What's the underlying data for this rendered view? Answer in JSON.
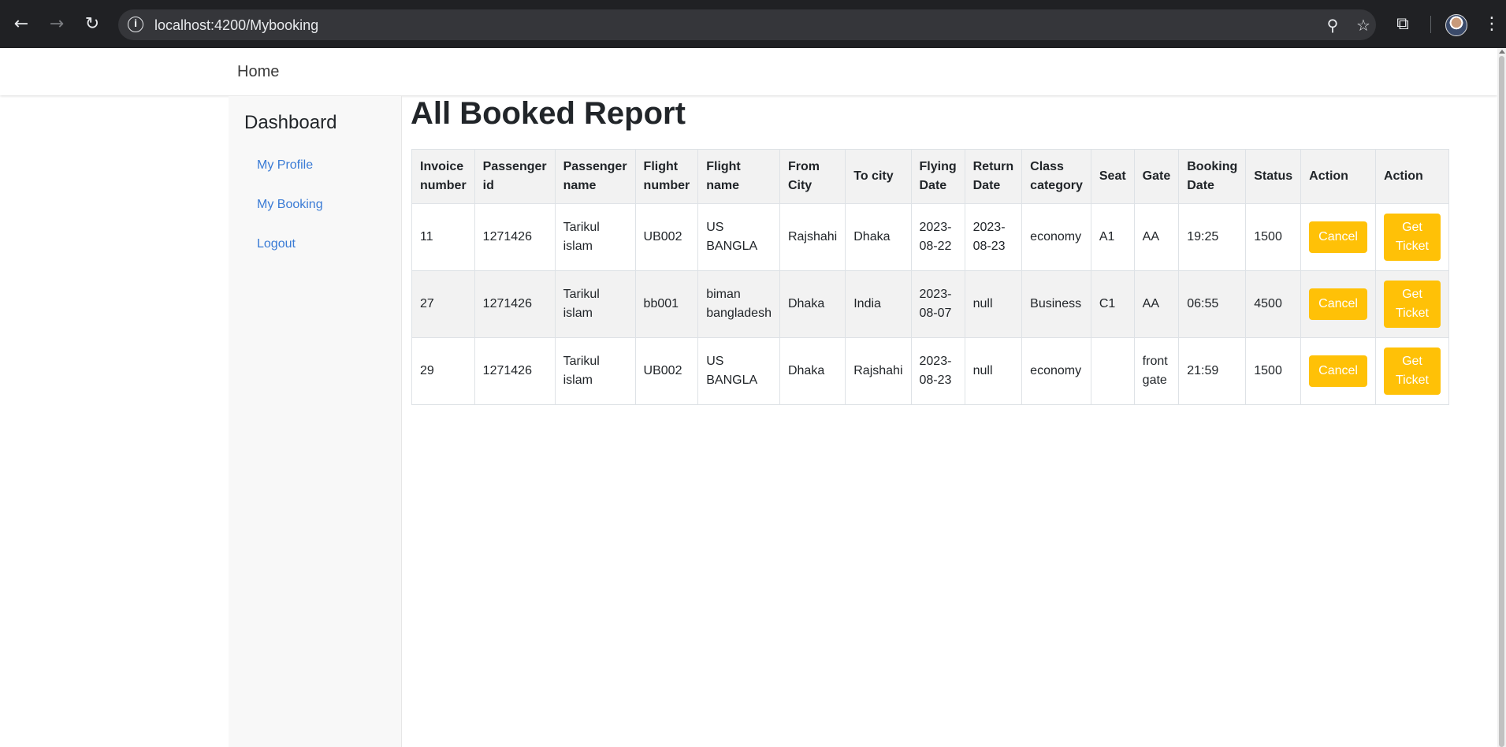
{
  "browser": {
    "url": "localhost:4200/Mybooking",
    "back_icon": "←",
    "forward_icon": "→",
    "reload_icon": "↻",
    "info_icon": "i",
    "zoom_icon": "⚲",
    "star_icon": "☆",
    "extensions_icon": "⧉",
    "menu_icon": "⋮"
  },
  "navbar": {
    "home_label": "Home"
  },
  "sidebar": {
    "title": "Dashboard",
    "links": [
      "My Profile",
      "My Booking",
      "Logout"
    ]
  },
  "page": {
    "title": "All Booked Report"
  },
  "table": {
    "headers": [
      [
        "Invoice",
        "number"
      ],
      [
        "Passenger",
        "id"
      ],
      [
        "Passenger",
        "name"
      ],
      [
        "Flight",
        "number"
      ],
      [
        "Flight",
        "name"
      ],
      [
        "From",
        "City"
      ],
      [
        "To city",
        ""
      ],
      [
        "Flying",
        "Date"
      ],
      [
        "Return",
        "Date"
      ],
      [
        "Class",
        "category"
      ],
      [
        "Seat",
        ""
      ],
      [
        "Gate",
        ""
      ],
      [
        "Booking",
        "Date"
      ],
      [
        "Status",
        ""
      ],
      [
        "Action",
        ""
      ],
      [
        "Action",
        ""
      ]
    ],
    "rows": [
      {
        "invoice": "11",
        "passenger_id": "1271426",
        "passenger_name": [
          "Tarikul",
          "islam"
        ],
        "flight_number": "UB002",
        "flight_name": [
          "US",
          "BANGLA"
        ],
        "from_city": "Rajshahi",
        "to_city": "Dhaka",
        "flying_date": [
          "2023-",
          "08-22"
        ],
        "return_date": [
          "2023-",
          "08-23"
        ],
        "class_category": "economy",
        "seat": "A1",
        "gate": [
          "AA",
          ""
        ],
        "booking_date": "19:25",
        "status": "1500",
        "cancel_label": "Cancel",
        "ticket_label": [
          "Get",
          "Ticket"
        ]
      },
      {
        "invoice": "27",
        "passenger_id": "1271426",
        "passenger_name": [
          "Tarikul",
          "islam"
        ],
        "flight_number": "bb001",
        "flight_name": [
          "biman",
          "bangladesh"
        ],
        "from_city": "Dhaka",
        "to_city": "India",
        "flying_date": [
          "2023-",
          "08-07"
        ],
        "return_date": [
          "null",
          ""
        ],
        "class_category": "Business",
        "seat": "C1",
        "gate": [
          "AA",
          ""
        ],
        "booking_date": "06:55",
        "status": "4500",
        "cancel_label": "Cancel",
        "ticket_label": [
          "Get",
          "Ticket"
        ]
      },
      {
        "invoice": "29",
        "passenger_id": "1271426",
        "passenger_name": [
          "Tarikul",
          "islam"
        ],
        "flight_number": "UB002",
        "flight_name": [
          "US",
          "BANGLA"
        ],
        "from_city": "Dhaka",
        "to_city": "Rajshahi",
        "flying_date": [
          "2023-",
          "08-23"
        ],
        "return_date": [
          "null",
          ""
        ],
        "class_category": "economy",
        "seat": "",
        "gate": [
          "front",
          "gate"
        ],
        "booking_date": "21:59",
        "status": "1500",
        "cancel_label": "Cancel",
        "ticket_label": [
          "Get",
          "Ticket"
        ]
      }
    ]
  },
  "colors": {
    "warning": "#ffc107",
    "link": "#3a7bd5",
    "chrome": "#202124"
  }
}
